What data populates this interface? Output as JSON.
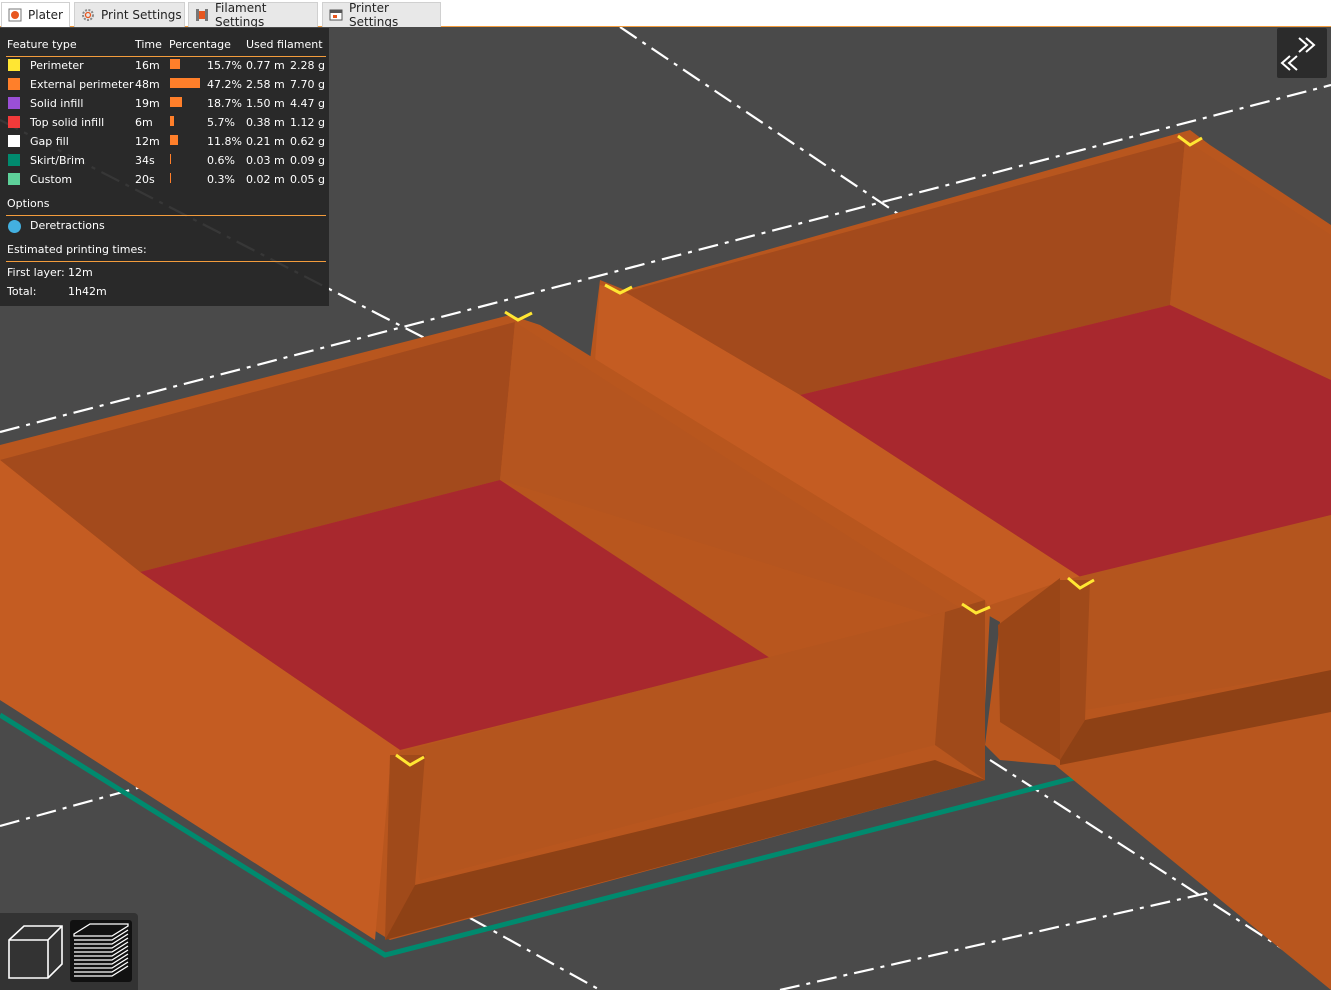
{
  "tabs": [
    {
      "label": "Plater",
      "icon": "plater-icon",
      "active": true
    },
    {
      "label": "Print Settings",
      "icon": "gear-icon",
      "active": false
    },
    {
      "label": "Filament Settings",
      "icon": "filament-spool-icon",
      "active": false
    },
    {
      "label": "Printer Settings",
      "icon": "printer-icon",
      "active": false
    }
  ],
  "legend": {
    "headers": {
      "feature": "Feature type",
      "time": "Time",
      "percentage": "Percentage",
      "filament": "Used filament"
    },
    "rows": [
      {
        "name": "Perimeter",
        "color": "#ffe633",
        "time": "16m",
        "pct": "15.7%",
        "pct_value": 15.7,
        "length": "0.77 m",
        "weight": "2.28 g"
      },
      {
        "name": "External perimeter",
        "color": "#ff7f2a",
        "time": "48m",
        "pct": "47.2%",
        "pct_value": 47.2,
        "length": "2.58 m",
        "weight": "7.70 g"
      },
      {
        "name": "Solid infill",
        "color": "#9a4fd6",
        "time": "19m",
        "pct": "18.7%",
        "pct_value": 18.7,
        "length": "1.50 m",
        "weight": "4.47 g"
      },
      {
        "name": "Top solid infill",
        "color": "#f23a3a",
        "time": "6m",
        "pct": "5.7%",
        "pct_value": 5.7,
        "length": "0.38 m",
        "weight": "1.12 g"
      },
      {
        "name": "Gap fill",
        "color": "#ffffff",
        "time": "12m",
        "pct": "11.8%",
        "pct_value": 11.8,
        "length": "0.21 m",
        "weight": "0.62 g"
      },
      {
        "name": "Skirt/Brim",
        "color": "#008a6e",
        "time": "34s",
        "pct": "0.6%",
        "pct_value": 0.6,
        "length": "0.03 m",
        "weight": "0.09 g"
      },
      {
        "name": "Custom",
        "color": "#5ed19a",
        "time": "20s",
        "pct": "0.3%",
        "pct_value": 0.3,
        "length": "0.02 m",
        "weight": "0.05 g"
      }
    ],
    "options_label": "Options",
    "options": [
      {
        "name": "Deretractions",
        "color": "#43b0e0"
      }
    ],
    "estimated_label": "Estimated printing times:",
    "first_layer_label": "First layer:",
    "first_layer_value": "12m",
    "total_label": "Total:",
    "total_value": "1h42m"
  },
  "colors": {
    "accent": "#f39c3c",
    "part_orange": "#c95f22",
    "top_red": "#a8282e",
    "bed_grey": "#4a4a4a",
    "skirt": "#008a6e"
  },
  "view_buttons": [
    {
      "icon": "3d-view-cube-icon"
    },
    {
      "icon": "preview-layers-icon"
    }
  ],
  "sidebar_toggle_icon": "collapse-sidebar-icon"
}
